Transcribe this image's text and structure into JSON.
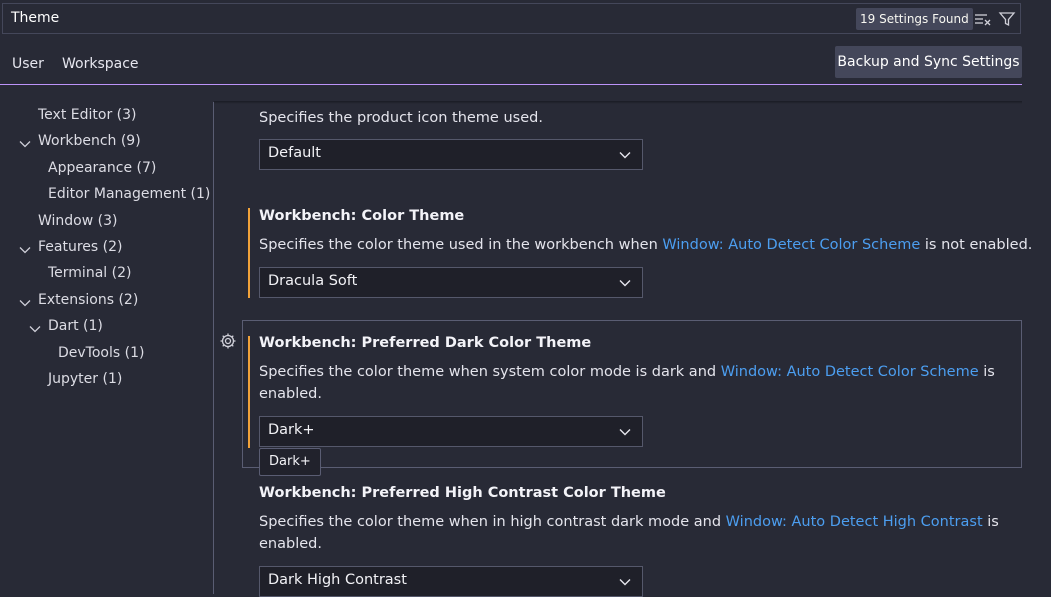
{
  "search": {
    "value": "Theme",
    "count_badge": "19 Settings Found"
  },
  "tabs": {
    "user": "User",
    "workspace": "Workspace"
  },
  "backup_button": "Backup and Sync Settings",
  "toc": [
    {
      "label": "Text Editor (3)"
    },
    {
      "label": "Workbench (9)"
    },
    {
      "label": "Appearance (7)"
    },
    {
      "label": "Editor Management (1)"
    },
    {
      "label": "Window (3)"
    },
    {
      "label": "Features (2)"
    },
    {
      "label": "Terminal (2)"
    },
    {
      "label": "Extensions (2)"
    },
    {
      "label": "Dart (1)"
    },
    {
      "label": "DevTools (1)"
    },
    {
      "label": "Jupyter (1)"
    }
  ],
  "settings": {
    "product_icon": {
      "desc": "Specifies the product icon theme used.",
      "value": "Default"
    },
    "color_theme": {
      "title": "Workbench: Color Theme",
      "desc_pre": "Specifies the color theme used in the workbench when ",
      "desc_link": "Window: Auto Detect Color Scheme",
      "desc_post": " is not enabled.",
      "value": "Dracula Soft"
    },
    "preferred_dark": {
      "title": "Workbench: Preferred Dark Color Theme",
      "desc_pre": "Specifies the color theme when system color mode is dark and ",
      "desc_link": "Window: Auto Detect Color Scheme",
      "desc_post": " is",
      "desc_line2": "enabled.",
      "value": "Dark+",
      "tooltip": "Dark+"
    },
    "preferred_hc": {
      "title": "Workbench: Preferred High Contrast Color Theme",
      "desc_pre": "Specifies the color theme when in high contrast dark mode and ",
      "desc_link": "Window: Auto Detect High Contrast",
      "desc_post": " is",
      "desc_line2": "enabled.",
      "value": "Dark High Contrast"
    }
  },
  "colors": {
    "background": "#282a36",
    "accent": "#bd93f9",
    "link": "#4c9ef0",
    "modified": "#f1a23a"
  }
}
